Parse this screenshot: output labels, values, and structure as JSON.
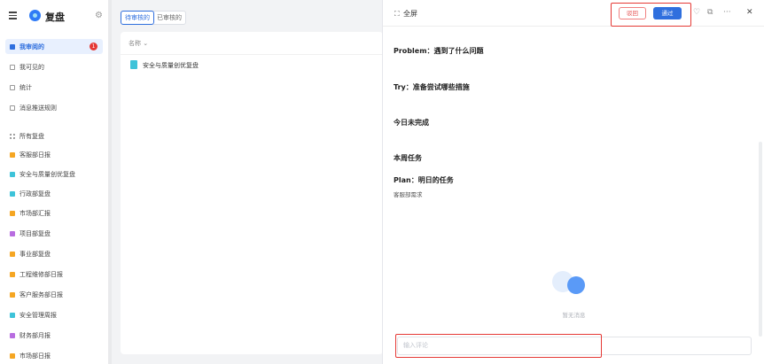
{
  "sidebar": {
    "title": "复盘",
    "nav": [
      {
        "label": "我审阅的",
        "badge": "1"
      },
      {
        "label": "我可见的"
      },
      {
        "label": "统计"
      },
      {
        "label": "消息推送规则"
      }
    ],
    "section_label": "所有复盘",
    "groups": [
      {
        "label": "客服部日报",
        "color": "#f5a623"
      },
      {
        "label": "安全与质量创优复盘",
        "color": "#3ec3d9"
      },
      {
        "label": "行政部复盘",
        "color": "#3ec3d9"
      },
      {
        "label": "市场部汇报",
        "color": "#f5a623"
      },
      {
        "label": "项目部复盘",
        "color": "#b86de0"
      },
      {
        "label": "事业部复盘",
        "color": "#f5a623"
      },
      {
        "label": "工程维修部日报",
        "color": "#f5a623"
      },
      {
        "label": "客户服务部日报",
        "color": "#f5a623"
      },
      {
        "label": "安全管理周报",
        "color": "#3ec3d9"
      },
      {
        "label": "财务部月报",
        "color": "#b86de0"
      },
      {
        "label": "市场部日报",
        "color": "#f5a623"
      }
    ]
  },
  "list": {
    "tabs": [
      "待审核的",
      "已审核的"
    ],
    "column_header": "名称 ⌄",
    "rows": [
      {
        "title": "安全与质量创优复盘"
      }
    ]
  },
  "detail": {
    "fullscreen_label": "全屏",
    "reject_label": "驳回",
    "pass_label": "通过",
    "sections": {
      "problem": "Problem：遇到了什么问题",
      "try": "Try：准备尝试哪些措施",
      "unfinished": "今日未完成",
      "weekly": "本周任务",
      "plan": "Plan：明日的任务",
      "plan_note": "客服部需求"
    },
    "empty_text": "暂无消息",
    "comment_placeholder": "输入评论"
  },
  "colors": {
    "accent": "#2f6fde",
    "highlight": "#e53935"
  }
}
